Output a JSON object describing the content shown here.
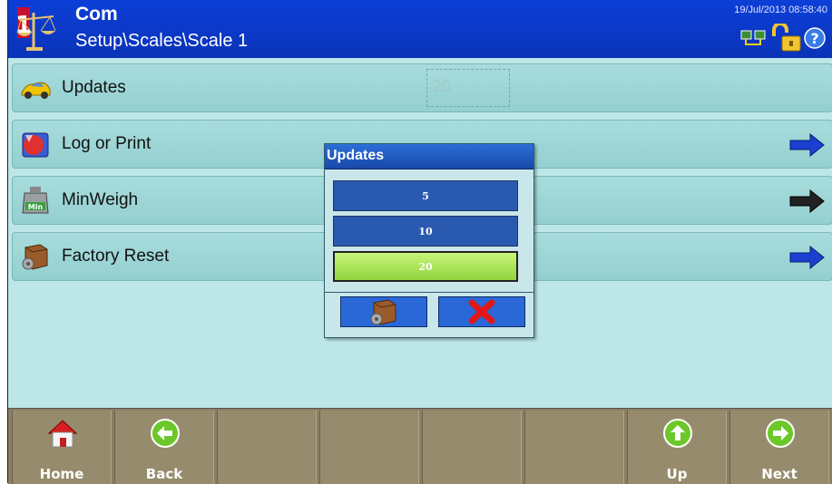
{
  "header": {
    "title": "Com",
    "path": "Setup\\Scales\\Scale 1",
    "timestamp": "19/Jul/2013 08:58:40",
    "icons": [
      "network-icon",
      "unlocked-padlock-icon",
      "help-icon"
    ]
  },
  "menu": {
    "items": [
      {
        "label": "Updates",
        "icon": "car-icon",
        "value": "20"
      },
      {
        "label": "Log or Print",
        "icon": "log-print-icon",
        "arrow_color": "#1b3fd0"
      },
      {
        "label": "MinWeigh",
        "icon": "minweigh-icon",
        "icon_text": "Min",
        "arrow_color": "#222222"
      },
      {
        "label": "Factory Reset",
        "icon": "factory-reset-icon",
        "arrow_color": "#1b3fd0"
      }
    ]
  },
  "dialog": {
    "title": "Updates",
    "options": [
      "5",
      "10",
      "20"
    ],
    "selected": "20",
    "buttons": [
      "reset-box-icon",
      "cancel-x-icon"
    ]
  },
  "softkeys": [
    {
      "label": "Home",
      "icon": "home-icon"
    },
    {
      "label": "Back",
      "icon": "back-arrow-icon"
    },
    {
      "label": "",
      "icon": ""
    },
    {
      "label": "",
      "icon": ""
    },
    {
      "label": "",
      "icon": ""
    },
    {
      "label": "",
      "icon": ""
    },
    {
      "label": "Up",
      "icon": "up-arrow-icon"
    },
    {
      "label": "Next",
      "icon": "next-arrow-icon"
    }
  ],
  "colors": {
    "header_blue": "#0c3fd8",
    "panel_teal": "#bde6e6",
    "selected_green": "#8fd43c",
    "softkey_tan": "#968b6c"
  }
}
